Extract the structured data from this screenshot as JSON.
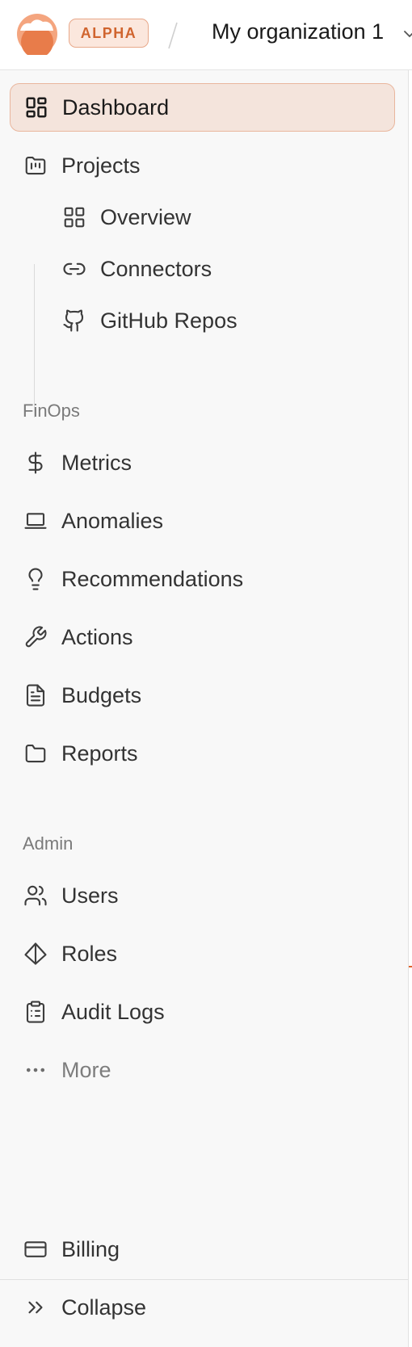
{
  "header": {
    "badge": "ALPHA",
    "organization": "My organization 1"
  },
  "nav": {
    "dashboard": "Dashboard",
    "projects": "Projects",
    "project_children": [
      "Overview",
      "Connectors",
      "GitHub Repos"
    ]
  },
  "finops": {
    "label": "FinOps",
    "items": [
      "Metrics",
      "Anomalies",
      "Recommendations",
      "Actions",
      "Budgets",
      "Reports"
    ]
  },
  "admin": {
    "label": "Admin",
    "items": [
      "Users",
      "Roles",
      "Audit Logs",
      "More"
    ]
  },
  "footer": {
    "items": [
      "Billing",
      "Collapse"
    ]
  },
  "colors": {
    "brand": "#e8895a",
    "active_bg": "#f4e4dc",
    "active_border": "#e9b69d",
    "badge_text": "#d0642e"
  }
}
